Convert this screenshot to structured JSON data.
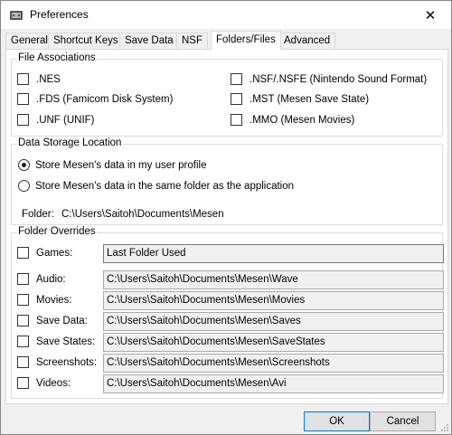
{
  "window": {
    "title": "Preferences",
    "close_glyph": "✕"
  },
  "tabs": [
    {
      "label": "General"
    },
    {
      "label": "Shortcut Keys"
    },
    {
      "label": "Save Data"
    },
    {
      "label": "NSF"
    },
    {
      "label": "Folders/Files",
      "active": true
    },
    {
      "label": "Advanced"
    }
  ],
  "file_associations": {
    "title": "File Associations",
    "items": [
      {
        "label": ".NES",
        "checked": false
      },
      {
        "label": ".FDS (Famicom Disk System)",
        "checked": false
      },
      {
        "label": ".UNF (UNIF)",
        "checked": false
      },
      {
        "label": ".NSF/.NSFE (Nintendo Sound Format)",
        "checked": false
      },
      {
        "label": ".MST (Mesen Save State)",
        "checked": false
      },
      {
        "label": ".MMO (Mesen Movies)",
        "checked": false
      }
    ]
  },
  "data_storage": {
    "title": "Data Storage Location",
    "options": [
      {
        "label": "Store Mesen's data in my user profile",
        "selected": true
      },
      {
        "label": "Store Mesen's data in the same folder as the application",
        "selected": false
      }
    ],
    "folder_label": "Folder:",
    "folder_value": "C:\\Users\\Saitoh\\Documents\\Mesen"
  },
  "folder_overrides": {
    "title": "Folder Overrides",
    "items": [
      {
        "label": "Games:",
        "value": "Last Folder Used",
        "checked": false
      },
      {
        "label": "Audio:",
        "value": "C:\\Users\\Saitoh\\Documents\\Mesen\\Wave",
        "checked": false
      },
      {
        "label": "Movies:",
        "value": "C:\\Users\\Saitoh\\Documents\\Mesen\\Movies",
        "checked": false
      },
      {
        "label": "Save Data:",
        "value": "C:\\Users\\Saitoh\\Documents\\Mesen\\Saves",
        "checked": false
      },
      {
        "label": "Save States:",
        "value": "C:\\Users\\Saitoh\\Documents\\Mesen\\SaveStates",
        "checked": false
      },
      {
        "label": "Screenshots:",
        "value": "C:\\Users\\Saitoh\\Documents\\Mesen\\Screenshots",
        "checked": false
      },
      {
        "label": "Videos:",
        "value": "C:\\Users\\Saitoh\\Documents\\Mesen\\Avi",
        "checked": false
      }
    ]
  },
  "buttons": {
    "ok": "OK",
    "cancel": "Cancel"
  },
  "colors": {
    "accent": "#0078d7",
    "window_bg": "#f0f0f0",
    "page_bg": "#ffffff"
  }
}
